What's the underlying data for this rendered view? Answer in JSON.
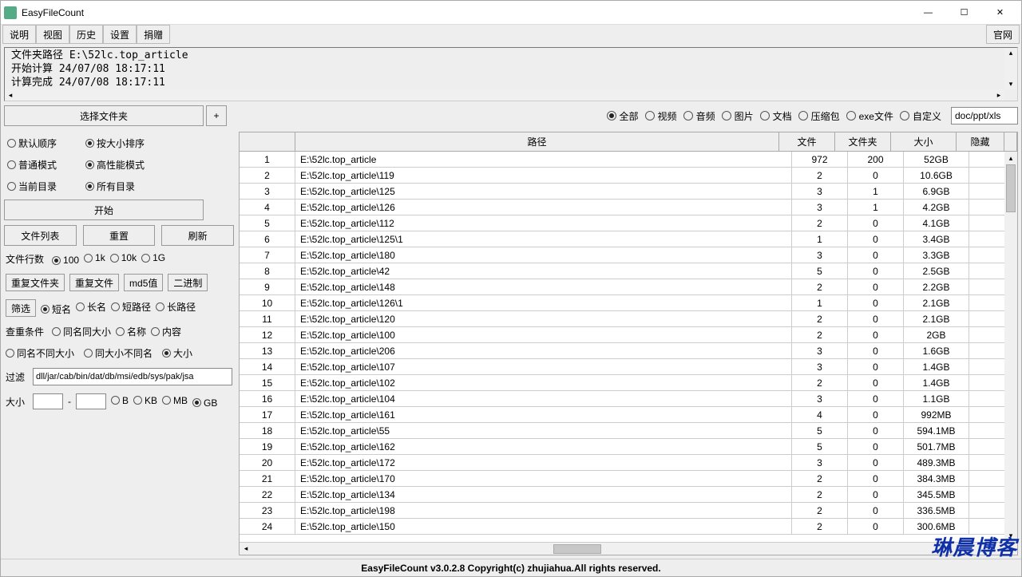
{
  "window": {
    "title": "EasyFileCount"
  },
  "menubar": {
    "items": [
      "说明",
      "视图",
      "历史",
      "设置",
      "捐赠"
    ],
    "right": "官网"
  },
  "log": "文件夹路径 E:\\52lc.top_article\n开始计算 24/07/08 18:17:11\n计算完成 24/07/08 18:17:11",
  "select_folder": "选择文件夹",
  "plus": "+",
  "type_filters": {
    "items": [
      "全部",
      "视频",
      "音频",
      "图片",
      "文档",
      "压缩包",
      "exe文件",
      "自定义"
    ],
    "selected": 0,
    "custom_value": "doc/ppt/xls"
  },
  "left": {
    "sort": {
      "a": "默认顺序",
      "b": "按大小排序",
      "sel": "b"
    },
    "mode": {
      "a": "普通模式",
      "b": "高性能模式",
      "sel": "b"
    },
    "scope": {
      "a": "当前目录",
      "b": "所有目录",
      "sel": "b"
    },
    "start": "开始",
    "btns": [
      "文件列表",
      "重置",
      "刷新"
    ],
    "rowcount_label": "文件行数",
    "rowcount_opts": [
      "100",
      "1k",
      "10k",
      "1G"
    ],
    "rowcount_sel": 0,
    "dup_btns": [
      "重复文件夹",
      "重复文件",
      "md5值",
      "二进制"
    ],
    "filter_btn": "筛选",
    "pathlen_opts": [
      "短名",
      "长名",
      "短路径",
      "长路径"
    ],
    "pathlen_sel": 0,
    "dupcond_label": "查重条件",
    "dupcond_row1": [
      "同名同大小",
      "名称",
      "内容"
    ],
    "dupcond_row2": [
      "同名不同大小",
      "同大小不同名",
      "大小"
    ],
    "dupcond_sel": "大小",
    "filter_label": "过滤",
    "filter_value": "dll/jar/cab/bin/dat/db/msi/edb/sys/pak/jsa",
    "size_label": "大小",
    "size_units": [
      "B",
      "KB",
      "MB",
      "GB"
    ],
    "size_unit_sel": 3
  },
  "table": {
    "headers": [
      "",
      "路径",
      "文件",
      "文件夹",
      "大小",
      "隐藏"
    ],
    "rows": [
      {
        "i": 1,
        "path": "E:\\52lc.top_article",
        "files": 972,
        "folders": 200,
        "size": "52GB"
      },
      {
        "i": 2,
        "path": "E:\\52lc.top_article\\119",
        "files": 2,
        "folders": 0,
        "size": "10.6GB"
      },
      {
        "i": 3,
        "path": "E:\\52lc.top_article\\125",
        "files": 3,
        "folders": 1,
        "size": "6.9GB"
      },
      {
        "i": 4,
        "path": "E:\\52lc.top_article\\126",
        "files": 3,
        "folders": 1,
        "size": "4.2GB"
      },
      {
        "i": 5,
        "path": "E:\\52lc.top_article\\112",
        "files": 2,
        "folders": 0,
        "size": "4.1GB"
      },
      {
        "i": 6,
        "path": "E:\\52lc.top_article\\125\\1",
        "files": 1,
        "folders": 0,
        "size": "3.4GB"
      },
      {
        "i": 7,
        "path": "E:\\52lc.top_article\\180",
        "files": 3,
        "folders": 0,
        "size": "3.3GB"
      },
      {
        "i": 8,
        "path": "E:\\52lc.top_article\\42",
        "files": 5,
        "folders": 0,
        "size": "2.5GB"
      },
      {
        "i": 9,
        "path": "E:\\52lc.top_article\\148",
        "files": 2,
        "folders": 0,
        "size": "2.2GB"
      },
      {
        "i": 10,
        "path": "E:\\52lc.top_article\\126\\1",
        "files": 1,
        "folders": 0,
        "size": "2.1GB"
      },
      {
        "i": 11,
        "path": "E:\\52lc.top_article\\120",
        "files": 2,
        "folders": 0,
        "size": "2.1GB"
      },
      {
        "i": 12,
        "path": "E:\\52lc.top_article\\100",
        "files": 2,
        "folders": 0,
        "size": "2GB"
      },
      {
        "i": 13,
        "path": "E:\\52lc.top_article\\206",
        "files": 3,
        "folders": 0,
        "size": "1.6GB"
      },
      {
        "i": 14,
        "path": "E:\\52lc.top_article\\107",
        "files": 3,
        "folders": 0,
        "size": "1.4GB"
      },
      {
        "i": 15,
        "path": "E:\\52lc.top_article\\102",
        "files": 2,
        "folders": 0,
        "size": "1.4GB"
      },
      {
        "i": 16,
        "path": "E:\\52lc.top_article\\104",
        "files": 3,
        "folders": 0,
        "size": "1.1GB"
      },
      {
        "i": 17,
        "path": "E:\\52lc.top_article\\161",
        "files": 4,
        "folders": 0,
        "size": "992MB"
      },
      {
        "i": 18,
        "path": "E:\\52lc.top_article\\55",
        "files": 5,
        "folders": 0,
        "size": "594.1MB"
      },
      {
        "i": 19,
        "path": "E:\\52lc.top_article\\162",
        "files": 5,
        "folders": 0,
        "size": "501.7MB"
      },
      {
        "i": 20,
        "path": "E:\\52lc.top_article\\172",
        "files": 3,
        "folders": 0,
        "size": "489.3MB"
      },
      {
        "i": 21,
        "path": "E:\\52lc.top_article\\170",
        "files": 2,
        "folders": 0,
        "size": "384.3MB"
      },
      {
        "i": 22,
        "path": "E:\\52lc.top_article\\134",
        "files": 2,
        "folders": 0,
        "size": "345.5MB"
      },
      {
        "i": 23,
        "path": "E:\\52lc.top_article\\198",
        "files": 2,
        "folders": 0,
        "size": "336.5MB"
      },
      {
        "i": 24,
        "path": "E:\\52lc.top_article\\150",
        "files": 2,
        "folders": 0,
        "size": "300.6MB"
      }
    ]
  },
  "footer": "EasyFileCount v3.0.2.8 Copyright(c) zhujiahua.All rights reserved.",
  "watermark": "琳晨博客"
}
